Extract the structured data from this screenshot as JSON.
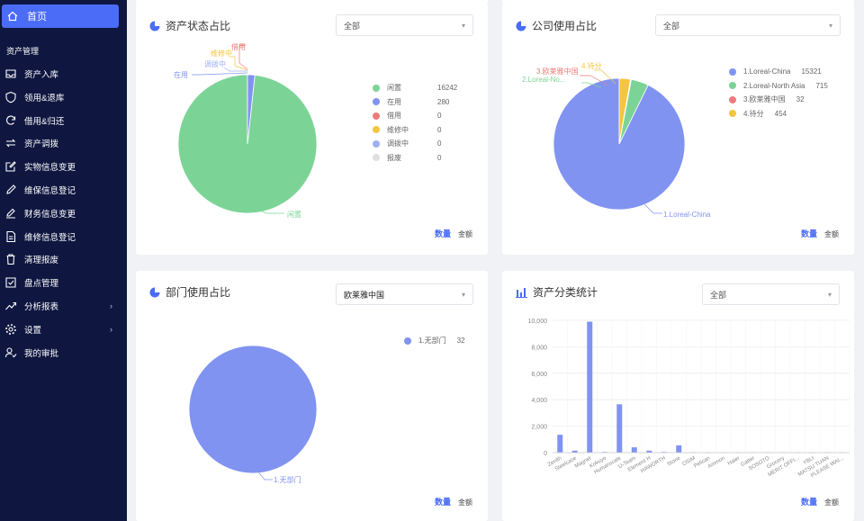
{
  "sidebar": {
    "home_label": "首页",
    "section_label": "资产管理",
    "items": [
      {
        "label": "资产入库",
        "icon": "inbox-icon",
        "chevron": false
      },
      {
        "label": "领用&退库",
        "icon": "shield-icon",
        "chevron": false
      },
      {
        "label": "借用&归还",
        "icon": "refresh-icon",
        "chevron": false
      },
      {
        "label": "资产调拨",
        "icon": "swap-icon",
        "chevron": false
      },
      {
        "label": "实物信息变更",
        "icon": "edit-icon",
        "chevron": false
      },
      {
        "label": "维保信息登记",
        "icon": "pen-icon",
        "chevron": false
      },
      {
        "label": "财务信息变更",
        "icon": "pencil-icon",
        "chevron": false
      },
      {
        "label": "维修信息登记",
        "icon": "document-icon",
        "chevron": false
      },
      {
        "label": "清理报废",
        "icon": "trash-icon",
        "chevron": false
      },
      {
        "label": "盘点管理",
        "icon": "checkbox-icon",
        "chevron": false
      },
      {
        "label": "分析报表",
        "icon": "trend-icon",
        "chevron": true
      },
      {
        "label": "设置",
        "icon": "gear-icon",
        "chevron": true
      },
      {
        "label": "我的审批",
        "icon": "user-check-icon",
        "chevron": false
      }
    ]
  },
  "cards": {
    "status": {
      "title": "资产状态占比",
      "select_value": "全部",
      "legend": [
        {
          "name": "闲置",
          "value": "16242",
          "color": "#7bd496"
        },
        {
          "name": "在用",
          "value": "280",
          "color": "#8093f1"
        },
        {
          "name": "借用",
          "value": "0",
          "color": "#ee7b7b"
        },
        {
          "name": "维修中",
          "value": "0",
          "color": "#f4c542"
        },
        {
          "name": "调拨中",
          "value": "0",
          "color": "#9db0f5"
        },
        {
          "name": "报废",
          "value": "0",
          "color": "#e0e0e0"
        }
      ],
      "callouts": {
        "a": "借用",
        "b": "维修中",
        "c": "调拨中",
        "d": "在用",
        "e": "闲置"
      },
      "tab_active": "数量",
      "tab_other": "金额"
    },
    "company": {
      "title": "公司使用占比",
      "select_value": "全部",
      "legend": [
        {
          "name": "1.Loreal-China",
          "value": "15321",
          "color": "#8093f1"
        },
        {
          "name": "2.Loreal-North Asia",
          "value": "715",
          "color": "#7bd496"
        },
        {
          "name": "3.欧莱雅中国",
          "value": "32",
          "color": "#ee7b7b"
        },
        {
          "name": "4.待分",
          "value": "454",
          "color": "#f4c542"
        }
      ],
      "callouts": {
        "a": "4.待分",
        "b": "3.欧莱雅中国",
        "c": "2.Loreal-No...",
        "d": "1.Loreal-China"
      },
      "tab_active": "数量",
      "tab_other": "金额"
    },
    "dept": {
      "title": "部门使用占比",
      "select_value": "欧莱雅中国",
      "legend": [
        {
          "name": "1.无部门",
          "value": "32",
          "color": "#8093f1"
        }
      ],
      "callout": "1.无部门",
      "tab_active": "数量",
      "tab_other": "金额"
    },
    "category": {
      "title": "资产分类统计",
      "select_value": "全部",
      "tab_active": "数量",
      "tab_other": "金额"
    }
  },
  "chart_data": [
    {
      "type": "pie",
      "title": "资产状态占比",
      "labels": [
        "闲置",
        "在用",
        "借用",
        "维修中",
        "调拨中",
        "报废"
      ],
      "values": [
        16242,
        280,
        0,
        0,
        0,
        0
      ],
      "colors": [
        "#7bd496",
        "#8093f1",
        "#ee7b7b",
        "#f4c542",
        "#9db0f5",
        "#e0e0e0"
      ],
      "legend_position": "right"
    },
    {
      "type": "pie",
      "title": "公司使用占比",
      "labels": [
        "1.Loreal-China",
        "2.Loreal-North Asia",
        "3.欧莱雅中国",
        "4.待分"
      ],
      "values": [
        15321,
        715,
        32,
        454
      ],
      "colors": [
        "#8093f1",
        "#7bd496",
        "#ee7b7b",
        "#f4c542"
      ],
      "legend_position": "top-right"
    },
    {
      "type": "pie",
      "title": "部门使用占比",
      "labels": [
        "1.无部门"
      ],
      "values": [
        32
      ],
      "colors": [
        "#8093f1"
      ],
      "legend_position": "top-right"
    },
    {
      "type": "bar",
      "title": "资产分类统计",
      "categories": [
        "Zenith",
        "Steelcase",
        "Magnet",
        "Kokuyo",
        "Humanscale",
        "U-Team",
        "Element H",
        "HAWORTH",
        "Stone",
        "OSIM",
        "Pelican",
        "Ammon",
        "Haier",
        "Gatter",
        "SOSOTO",
        "Grocery",
        "MERIT OFFI...",
        "YBLI",
        "MATSU TUAN",
        "PLEASE WAI..."
      ],
      "values": [
        1350,
        150,
        9900,
        50,
        3650,
        400,
        150,
        50,
        550,
        20,
        20,
        20,
        20,
        20,
        20,
        20,
        20,
        20,
        20,
        20
      ],
      "ylim": [
        0,
        10000
      ],
      "yticks": [
        "0",
        "2,000",
        "4,000",
        "6,000",
        "8,000",
        "10,000"
      ],
      "grid": true,
      "color": "#8093f1"
    }
  ]
}
